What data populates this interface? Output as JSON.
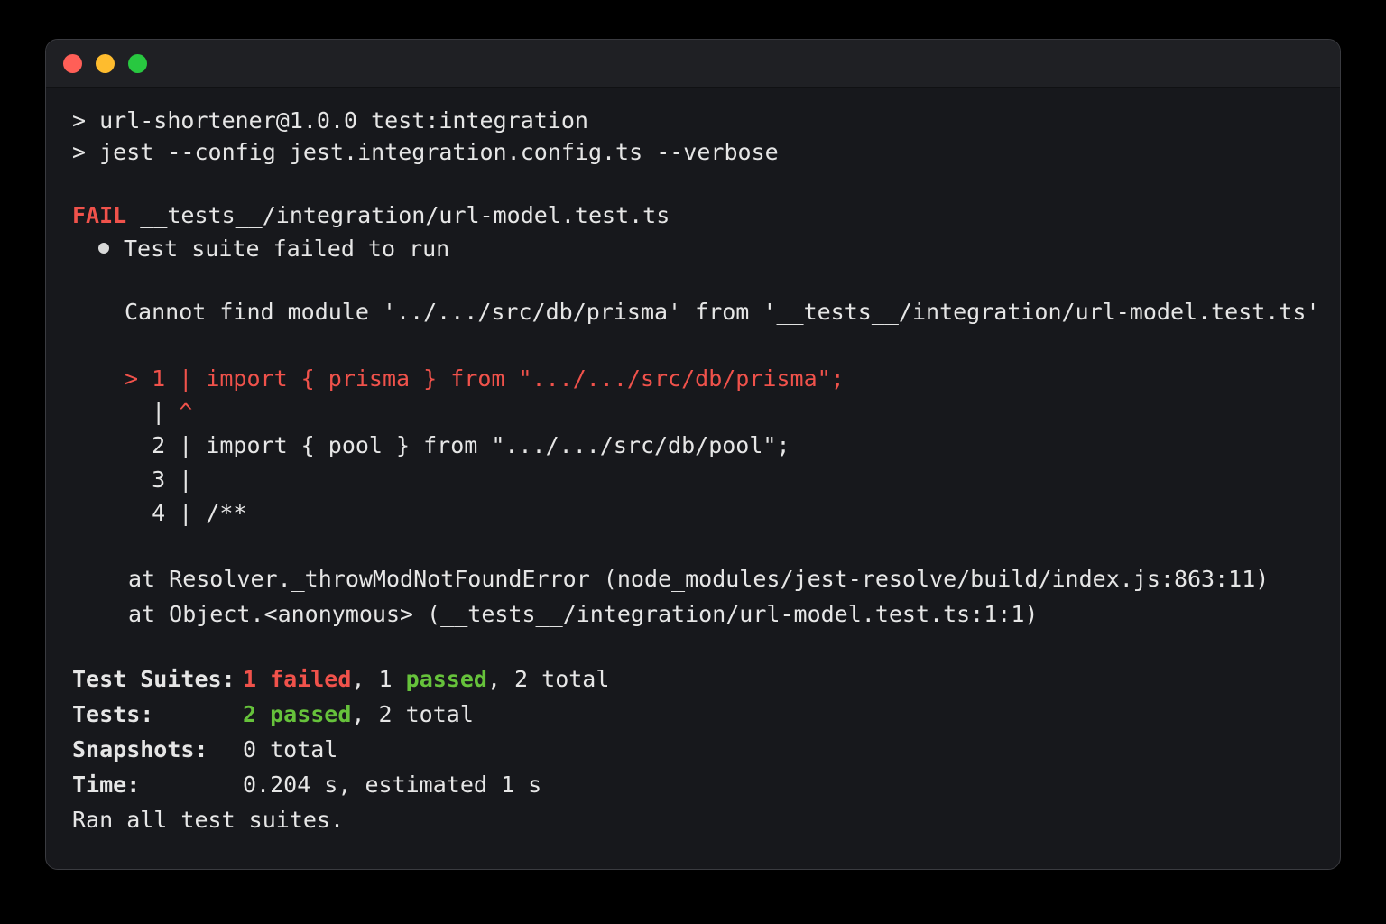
{
  "window": {
    "controls": [
      "close",
      "minimize",
      "maximize"
    ]
  },
  "colors": {
    "fail": "#f0524b",
    "pass": "#66c23b",
    "text": "#e6e6e6",
    "background": "#17181c"
  },
  "terminal": {
    "cmd_line_1": "> url-shortener@1.0.0 test:integration",
    "cmd_line_2": "> jest --config jest.integration.config.ts --verbose",
    "fail_label": "FAIL",
    "fail_path": " __tests__/integration/url-model.test.ts",
    "suite_error": "Test suite failed to run",
    "error_message": "Cannot find module '../.../src/db/prisma' from '__tests__/integration/url-model.test.ts'",
    "code": {
      "line1_marker": "> 1 | ",
      "line1_code": "import { prisma } from \".../.../src/db/prisma\";",
      "caret_gutter": "  | ",
      "caret": "^",
      "line2": "  2 | import { pool } from \".../.../src/db/pool\";",
      "line3": "  3 |",
      "line4": "  4 | /**"
    },
    "stack_1": "at Resolver._throwModNotFoundError (node_modules/jest-resolve/build/index.js:863:11)",
    "stack_2": "at Object.<anonymous> (__tests__/integration/url-model.test.ts:1:1)",
    "summary": {
      "suites_label": "Test Suites:",
      "suites_failed": "1 failed",
      "suites_sep1": ", 1 ",
      "suites_passed": "passed",
      "suites_rest": ", 2 total",
      "tests_label": "Tests:",
      "tests_passed": "2 passed",
      "tests_rest": ", 2 total",
      "snapshots_label": "Snapshots:",
      "snapshots_value": "0 total",
      "time_label": "Time:",
      "time_value": "0.204 s, estimated 1 s",
      "ran_all": "Ran all test suites."
    }
  }
}
